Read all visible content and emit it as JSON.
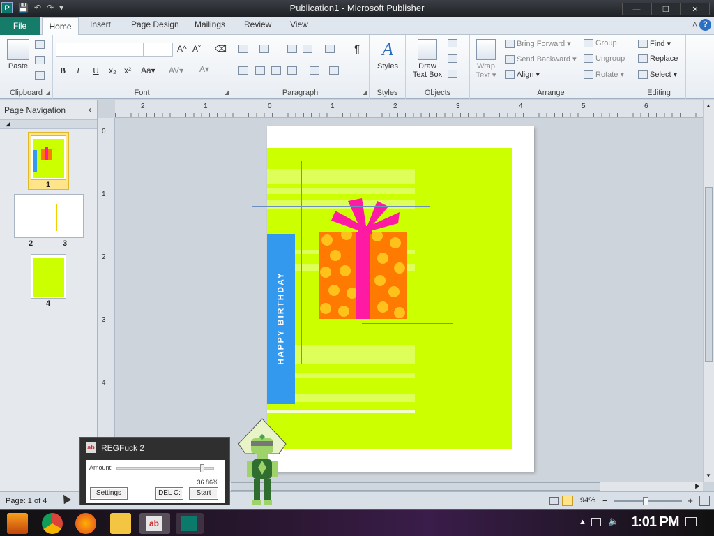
{
  "window": {
    "title": "Publication1 - Microsoft Publisher",
    "app_icon": "P"
  },
  "qat": {
    "save": "💾",
    "undo": "↶",
    "redo": "↷",
    "customize": "▾"
  },
  "window_buttons": {
    "minimize": "—",
    "restore": "❐",
    "close": "✕"
  },
  "tabs": [
    "File",
    "Home",
    "Insert",
    "Page Design",
    "Mailings",
    "Review",
    "View"
  ],
  "ribbon": {
    "clipboard": {
      "paste": "Paste",
      "label": "Clipboard"
    },
    "font": {
      "label": "Font",
      "bold": "B",
      "italic": "I",
      "underline": "U",
      "subscript": "x₂",
      "superscript": "x²",
      "case": "Aa▾",
      "spacing": "AV▾",
      "color": "A▾",
      "grow": "A^",
      "shrink": "Aˇ"
    },
    "paragraph": {
      "label": "Paragraph",
      "pilcrow": "¶"
    },
    "styles": {
      "button": "Styles",
      "label": "Styles"
    },
    "objects": {
      "draw_text_box_1": "Draw",
      "draw_text_box_2": "Text Box",
      "label": "Objects"
    },
    "arrange": {
      "wrap_1": "Wrap",
      "wrap_2": "Text ▾",
      "bring_forward": "Bring Forward ▾",
      "send_backward": "Send Backward ▾",
      "align": "Align ▾",
      "group": "Group",
      "ungroup": "Ungroup",
      "rotate": "Rotate ▾",
      "label": "Arrange"
    },
    "editing": {
      "find": "Find ▾",
      "replace": "Replace",
      "select": "Select ▾",
      "label": "Editing"
    }
  },
  "nav": {
    "header": "Page Navigation",
    "collapse": "‹",
    "section_toggle": "◢",
    "pages": [
      {
        "label": "1"
      },
      {
        "label": "2"
      },
      {
        "label": "3"
      },
      {
        "label": "4"
      }
    ]
  },
  "ruler_h": [
    "2",
    "1",
    "0",
    "1",
    "2",
    "3",
    "4",
    "5",
    "6"
  ],
  "ruler_v": [
    "0",
    "1",
    "2",
    "3",
    "4"
  ],
  "card": {
    "text": "HAPPY BIRTHDAY",
    "bg": "#ccff00",
    "stripe_color": "#3399ee",
    "gift_box": "#ff7a00",
    "ribbon": "#ff1aa3",
    "dots": "#ffc21a"
  },
  "status": {
    "page": "Page: 1 of 4",
    "zoom": "94%",
    "zoom_out": "−",
    "zoom_in": "+"
  },
  "dialog": {
    "title": "REGFuck 2",
    "icon": "ab",
    "amount_label": "Amount:",
    "amount_value": "36.86%",
    "amount_fraction": 0.8686,
    "settings": "Settings",
    "del": "DEL C:",
    "start": "Start"
  },
  "taskbar": {
    "clock": "1:01 PM"
  }
}
